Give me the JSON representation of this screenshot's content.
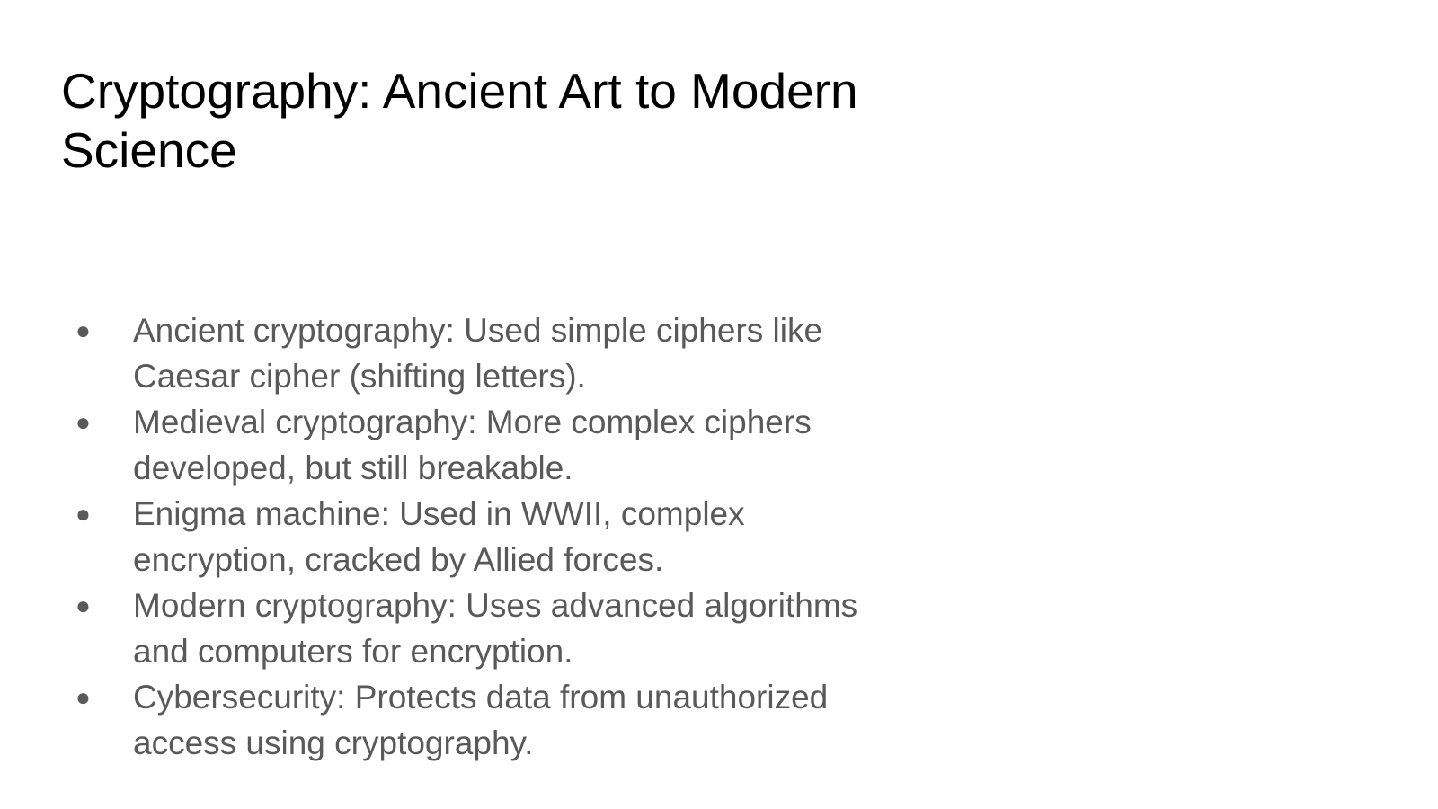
{
  "slide": {
    "title": "Cryptography: Ancient Art to Modern Science",
    "bullet_glyph": "●",
    "bullets": [
      "Ancient cryptography: Used simple ciphers like Caesar cipher (shifting letters).",
      "Medieval cryptography: More complex ciphers developed, but still breakable.",
      "Enigma machine: Used in WWII, complex encryption, cracked by Allied forces.",
      "Modern cryptography: Uses advanced algorithms and computers for encryption.",
      "Cybersecurity: Protects data from unauthorized access using cryptography."
    ]
  },
  "colors": {
    "background": "#ffffff",
    "title_text": "#000000",
    "body_text": "#595959"
  }
}
